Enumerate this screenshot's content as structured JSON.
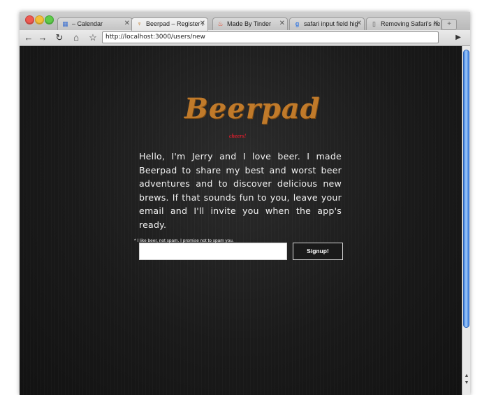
{
  "browser": {
    "tabs": [
      {
        "favicon": "calendar-icon",
        "title": "– Calendar"
      },
      {
        "favicon": "beer-icon",
        "title": "Beerpad – Register f"
      },
      {
        "favicon": "flame-icon",
        "title": "Made By Tinder"
      },
      {
        "favicon": "google-icon",
        "title": "safari input field hig"
      },
      {
        "favicon": "document-icon",
        "title": "Removing Safari's ne"
      }
    ],
    "address": "http://localhost:3000/users/new",
    "accent": "#3f82e0"
  },
  "page": {
    "logo": "Beerpad",
    "tagline": "cheers!",
    "intro": "Hello, I'm Jerry and I love beer. I made Beerpad to share my best and worst beer adventures and to discover delicious new brews. If that sounds fun to you, leave your email and I'll invite you when the app's ready.",
    "fineprint": "* I like beer, not spam. I promise not to spam you.",
    "email_value": "",
    "signup_label": "Signup!",
    "colors": {
      "logo": "#c07a2a",
      "tagline": "#d61e2c",
      "background": "#161616"
    }
  }
}
